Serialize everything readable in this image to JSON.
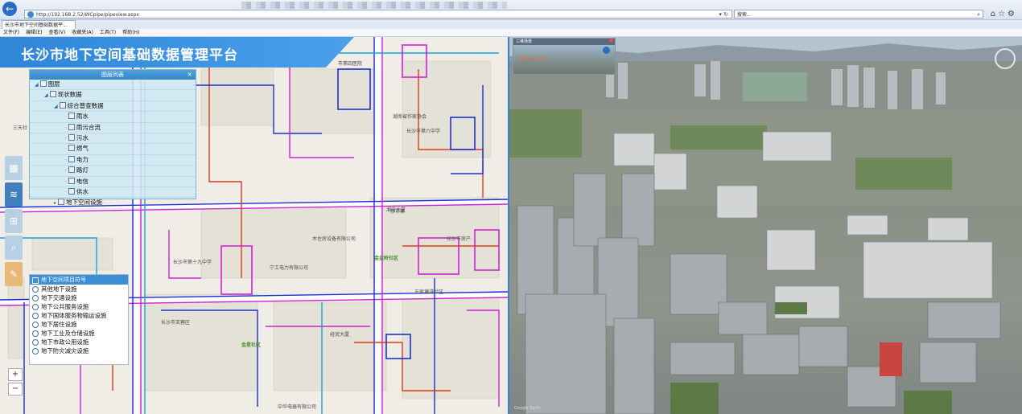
{
  "browser": {
    "url": "http://192.168.2.52/WCpipe/pipeview.aspx",
    "search_placeholder": "搜索...",
    "tab_title": "长沙市地下空间基础数据平...",
    "menu": [
      "文件(F)",
      "编辑(E)",
      "查看(V)",
      "收藏夹(A)",
      "工具(T)",
      "帮助(H)"
    ]
  },
  "banner": {
    "title": "长沙市地下空间基础数据管理平台"
  },
  "layer_panel": {
    "title": "图层列表",
    "close": "×",
    "items": [
      {
        "label": "图层",
        "level": 0
      },
      {
        "label": "现状数据",
        "level": 1
      },
      {
        "label": "综合普查数据",
        "level": 2
      },
      {
        "label": "雨水",
        "level": 3
      },
      {
        "label": "雨污合流",
        "level": 3
      },
      {
        "label": "污水",
        "level": 3
      },
      {
        "label": "燃气",
        "level": 3
      },
      {
        "label": "电力",
        "level": 3
      },
      {
        "label": "路灯",
        "level": 3
      },
      {
        "label": "电信",
        "level": 3
      },
      {
        "label": "供水",
        "level": 3
      },
      {
        "label": "地下空间设施",
        "level": 2
      }
    ]
  },
  "legend": {
    "title": "地下空间项目符号",
    "items": [
      "其他地下设施",
      "地下交通设施",
      "地下公共服务设施",
      "地下国体服务物输运设施",
      "地下居住设施",
      "地下工业及仓储设施",
      "地下市政公用设施",
      "地下防灾减灾设施"
    ]
  },
  "zoom": {
    "in": "+",
    "out": "−"
  },
  "map_labels": [
    "市第四医院",
    "湖南省作家协会",
    "长沙市第六中学",
    "沙市第",
    "木住房设备有限公司",
    "金盆岭社区",
    "宁工电力有限公司",
    "长沙市房产",
    "金星社区",
    "三天社",
    "中华电器有限公司",
    "左家塘湾社区",
    "长沙市芙蓉区",
    "长沙市第十九中学",
    "湘府大厦",
    "经贸大厦"
  ],
  "scene_window": {
    "title": "三维场景",
    "scale_text": "当前比例 100%"
  },
  "scene_footer": "Google Earth"
}
